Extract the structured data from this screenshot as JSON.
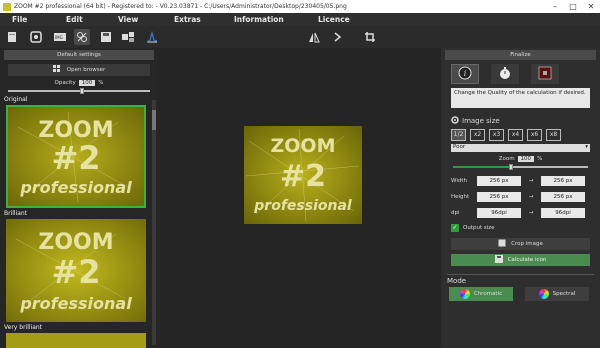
{
  "window": {
    "title": "ZOOM #2 professional (64 bit) - Registered to: - V0.23.03871 - C:/Users/Administrator/Desktop/230405/05.png"
  },
  "menu": [
    "File",
    "Edit",
    "View",
    "Extras",
    "Information",
    "Licence"
  ],
  "left_panel": {
    "header": "Default settings",
    "open_browser": "Open browser",
    "opacity_label": "Opacity",
    "opacity_value": "100",
    "opacity_unit": "%",
    "thumbnails": [
      {
        "label": "Original"
      },
      {
        "label": "Brilliant"
      },
      {
        "label": "Very brilliant"
      }
    ]
  },
  "preview": {
    "line1": "ZOOM",
    "line2": "#2",
    "line3": "professional"
  },
  "right_panel": {
    "header": "Finalize",
    "hint": "Change the Quality of the calculation if desired.",
    "image_size_title": "Image size",
    "scale_buttons": [
      "1/2",
      "x2",
      "x3",
      "x4",
      "x6",
      "x8"
    ],
    "selected_scale": "1/2",
    "resample_value": "Poor",
    "zoom_label": "Zoom",
    "zoom_value": "100",
    "zoom_unit": "%",
    "width_label": "Width",
    "width_from": "256 px",
    "width_to": "256 px",
    "height_label": "Height",
    "height_from": "256 px",
    "height_to": "256 px",
    "dpi_label": "dpi",
    "dpi_from": "96dpi",
    "dpi_to": "96dpi",
    "output_size_label": "Output size",
    "crop_label": "Crop image",
    "calculate_label": "Calculate icon",
    "mode_title": "Mode",
    "modes": [
      "Chromatic",
      "Spectral"
    ],
    "selected_mode": "Chromatic"
  },
  "colors": {
    "accent_green": "#2e9c3a",
    "image_yellow": "#9a9410",
    "panel_dark": "#262626"
  }
}
